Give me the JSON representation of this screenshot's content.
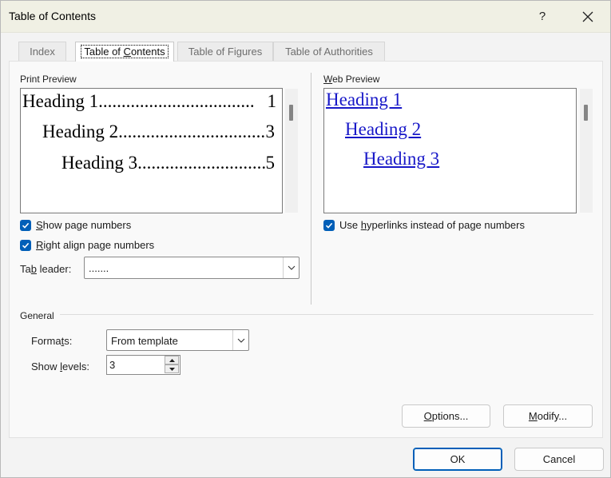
{
  "window": {
    "title": "Table of Contents",
    "help": "?",
    "close": "✕"
  },
  "tabs": [
    {
      "label": "Index"
    },
    {
      "label_pre": "Table of ",
      "label_u": "C",
      "label_post": "ontents"
    },
    {
      "label": "Table of Figures"
    },
    {
      "label": "Table of Authorities"
    }
  ],
  "print_preview": {
    "label_u": "",
    "label": "Print Preview",
    "lines": [
      {
        "text": "Heading 1",
        "dots": "..................................",
        "page": "1"
      },
      {
        "text": "Heading 2",
        "dots": "..................................",
        "page": "3"
      },
      {
        "text": "Heading 3",
        "dots": "..................................",
        "page": "5"
      }
    ]
  },
  "web_preview": {
    "label_u": "W",
    "label_rest": "eb Preview",
    "links": [
      "Heading 1",
      "Heading 2",
      "Heading 3"
    ]
  },
  "options": {
    "show_page_numbers": {
      "u": "S",
      "rest": "how page numbers",
      "checked": true
    },
    "right_align": {
      "u": "R",
      "rest": "ight align page numbers",
      "checked": true
    },
    "use_hyperlinks": {
      "pre": "Use ",
      "u": "h",
      "rest": "yperlinks instead of page numbers",
      "checked": true
    },
    "tab_leader": {
      "pre": "Ta",
      "u": "b",
      "rest": " leader:",
      "value": "......."
    }
  },
  "general": {
    "label": "General",
    "formats": {
      "pre": "Forma",
      "u": "t",
      "rest": "s:",
      "value": "From template"
    },
    "show_levels": {
      "pre": "Show ",
      "u": "l",
      "rest": "evels:",
      "value": "3"
    }
  },
  "buttons": {
    "options": {
      "u": "O",
      "rest": "ptions..."
    },
    "modify": {
      "u": "M",
      "rest": "odify..."
    },
    "ok": "OK",
    "cancel": "Cancel"
  },
  "colors": {
    "accent": "#005fb8",
    "link": "#1818c8",
    "titlebar": "#f0f0e4"
  }
}
